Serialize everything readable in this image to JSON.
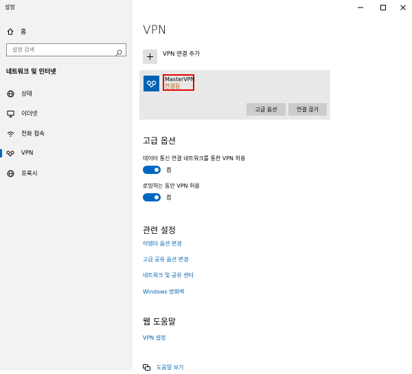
{
  "window": {
    "title": "설정"
  },
  "sidebar": {
    "home_label": "홈",
    "search_placeholder": "설정 검색",
    "section_title": "네트워크 및 인터넷",
    "items": [
      {
        "label": "상태",
        "icon": "globe-status-icon"
      },
      {
        "label": "이더넷",
        "icon": "ethernet-icon"
      },
      {
        "label": "전화 접속",
        "icon": "dialup-icon"
      },
      {
        "label": "VPN",
        "icon": "vpn-icon",
        "active": true
      },
      {
        "label": "프록시",
        "icon": "proxy-globe-icon"
      }
    ]
  },
  "main": {
    "title": "VPN",
    "add_vpn_label": "VPN 연결 추가",
    "vpn_connection": {
      "name": "MasterVPN",
      "status": "연결됨",
      "advanced_button": "고급 옵션",
      "disconnect_button": "연결 끊기"
    },
    "advanced": {
      "heading": "고급 옵션",
      "metered_label": "데이터 통신 연결 네트워크를 통한 VPN 허용",
      "metered_state": "켬",
      "roaming_label": "로밍하는 동안 VPN 허용",
      "roaming_state": "켬"
    },
    "related": {
      "heading": "관련 설정",
      "links": [
        "어댑터 옵션 변경",
        "고급 공유 옵션 변경",
        "네트워크 및 공유 센터",
        "Windows 방화벽"
      ]
    },
    "web_help": {
      "heading": "웹 도움말",
      "link": "VPN 설정"
    },
    "get_help": "도움말 보기"
  },
  "colors": {
    "accent": "#0067c0",
    "link": "#0063b1",
    "status": "#c05a00",
    "highlight_border": "#e00000"
  }
}
